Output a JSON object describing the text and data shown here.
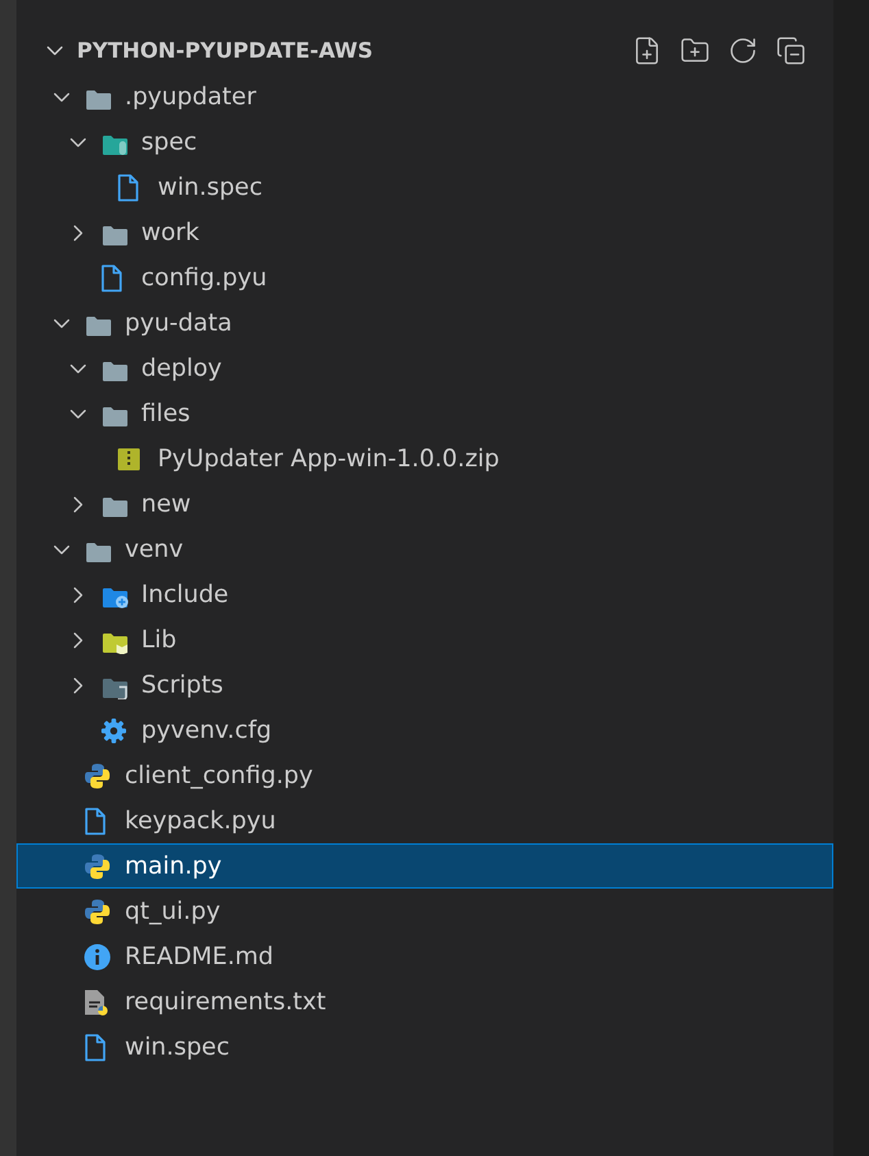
{
  "explorer": {
    "title": "PYTHON-PYUPDATE-AWS",
    "expanded": true,
    "tree": [
      {
        "name": ".pyupdater",
        "kind": "folder",
        "expanded": true,
        "selected": false,
        "children": [
          {
            "name": "spec",
            "kind": "folder-test",
            "expanded": true,
            "selected": false,
            "children": [
              {
                "name": "win.spec",
                "kind": "file",
                "selected": false
              }
            ]
          },
          {
            "name": "work",
            "kind": "folder",
            "expanded": false,
            "selected": false
          },
          {
            "name": "config.pyu",
            "kind": "file",
            "selected": false
          }
        ]
      },
      {
        "name": "pyu-data",
        "kind": "folder",
        "expanded": true,
        "selected": false,
        "children": [
          {
            "name": "deploy",
            "kind": "folder",
            "expanded": true,
            "selected": false
          },
          {
            "name": "files",
            "kind": "folder",
            "expanded": true,
            "selected": false,
            "children": [
              {
                "name": "PyUpdater App-win-1.0.0.zip",
                "kind": "zip",
                "selected": false
              }
            ]
          },
          {
            "name": "new",
            "kind": "folder",
            "expanded": false,
            "selected": false
          }
        ]
      },
      {
        "name": "venv",
        "kind": "folder",
        "expanded": true,
        "selected": false,
        "children": [
          {
            "name": "Include",
            "kind": "folder-include",
            "expanded": false,
            "selected": false
          },
          {
            "name": "Lib",
            "kind": "folder-lib",
            "expanded": false,
            "selected": false
          },
          {
            "name": "Scripts",
            "kind": "folder-scripts",
            "expanded": false,
            "selected": false
          },
          {
            "name": "pyvenv.cfg",
            "kind": "gear",
            "selected": false
          }
        ]
      },
      {
        "name": "client_config.py",
        "kind": "python",
        "selected": false
      },
      {
        "name": "keypack.pyu",
        "kind": "file",
        "selected": false
      },
      {
        "name": "main.py",
        "kind": "python",
        "selected": true
      },
      {
        "name": "qt_ui.py",
        "kind": "python",
        "selected": false
      },
      {
        "name": "README.md",
        "kind": "info",
        "selected": false
      },
      {
        "name": "requirements.txt",
        "kind": "requirements",
        "selected": false
      },
      {
        "name": "win.spec",
        "kind": "file",
        "selected": false
      }
    ]
  }
}
